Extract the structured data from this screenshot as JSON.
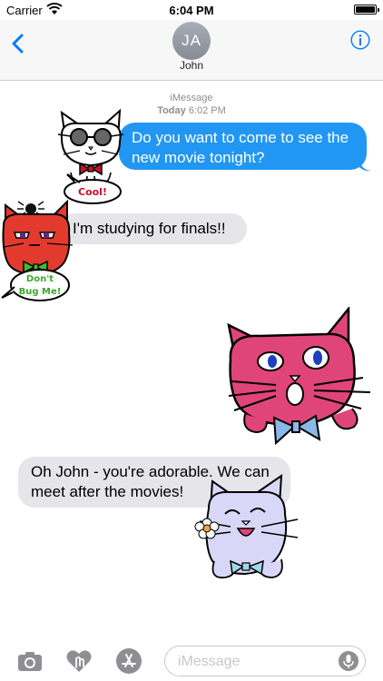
{
  "status": {
    "carrier": "Carrier",
    "time": "6:04 PM"
  },
  "nav": {
    "initials": "JA",
    "name": "John"
  },
  "timestamp": {
    "service": "iMessage",
    "day": "Today",
    "time": "6:02 PM"
  },
  "messages": [
    {
      "text": "Do you want to come to see the new movie tonight?",
      "direction": "outgoing"
    },
    {
      "text": "I'm studying for finals!!",
      "direction": "incoming"
    },
    {
      "text": "Oh John - you're adorable. We can meet after the movies!",
      "direction": "incoming"
    }
  ],
  "stickers": {
    "cool": {
      "caption": "Cool!"
    },
    "dont_bug": {
      "line1": "Don't",
      "line2": "Bug Me!"
    }
  },
  "input": {
    "placeholder": "iMessage"
  },
  "colors": {
    "accent": "#007aff",
    "outgoing": "#2196f3",
    "incoming": "#e5e5ea"
  },
  "icons": [
    "back-chevron-icon",
    "info-icon",
    "camera-icon",
    "digital-touch-icon",
    "app-store-icon",
    "microphone-icon"
  ]
}
